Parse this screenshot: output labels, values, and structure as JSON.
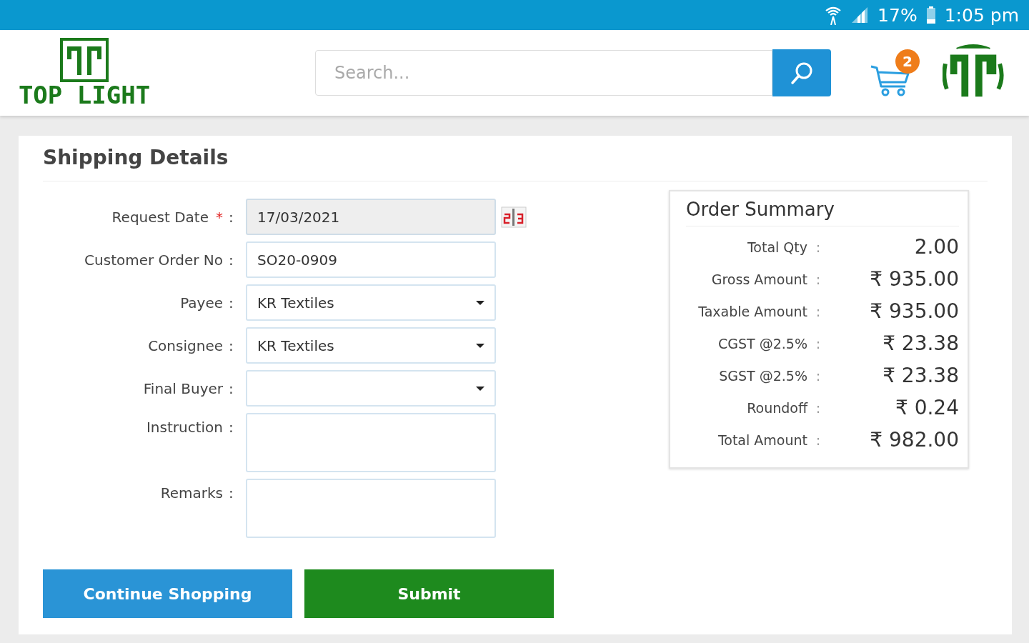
{
  "status_bar": {
    "battery": "17%",
    "time": "1:05 pm"
  },
  "header": {
    "logo_text": "TOP LIGHT",
    "search": {
      "placeholder": "Search..."
    },
    "cart_count": "2"
  },
  "shipping": {
    "title": "Shipping Details",
    "fields": [
      {
        "label": "Request Date",
        "required_mark": "*",
        "colon": ":",
        "kind": "date",
        "value": "17/03/2021",
        "disabled": true
      },
      {
        "label": "Customer Order No",
        "colon": ":",
        "kind": "text",
        "value": "SO20-0909",
        "disabled": false
      },
      {
        "label": "Payee",
        "colon": ":",
        "kind": "select",
        "value": "KR Textiles",
        "disabled": false
      },
      {
        "label": "Consignee",
        "colon": ":",
        "kind": "select",
        "value": "KR Textiles",
        "disabled": false
      },
      {
        "label": "Final Buyer",
        "colon": ":",
        "kind": "select",
        "disabled": false
      },
      {
        "label": "Instruction",
        "colon": ":",
        "kind": "textarea",
        "disabled": false
      },
      {
        "label": "Remarks",
        "colon": ":",
        "kind": "textarea",
        "disabled": false
      }
    ]
  },
  "order_summary": {
    "title": "Order Summary",
    "rows": [
      {
        "label": "Total Qty",
        "colon": ":",
        "value": "2.00"
      },
      {
        "label": "Gross Amount",
        "colon": ":",
        "value": "₹ 935.00"
      },
      {
        "label": "Taxable Amount",
        "colon": ":",
        "value": "₹ 935.00"
      },
      {
        "label": "CGST @2.5%",
        "colon": ":",
        "value": "₹ 23.38"
      },
      {
        "label": "SGST @2.5%",
        "colon": ":",
        "value": "₹ 23.38"
      },
      {
        "label": "Roundoff",
        "colon": ":",
        "value": "₹ 0.24"
      },
      {
        "label": "Total Amount",
        "colon": ":",
        "value": "₹ 982.00"
      }
    ]
  },
  "buttons": [
    {
      "label": "Continue Shopping",
      "kind": "primary"
    },
    {
      "label": "Submit",
      "kind": "success"
    }
  ]
}
